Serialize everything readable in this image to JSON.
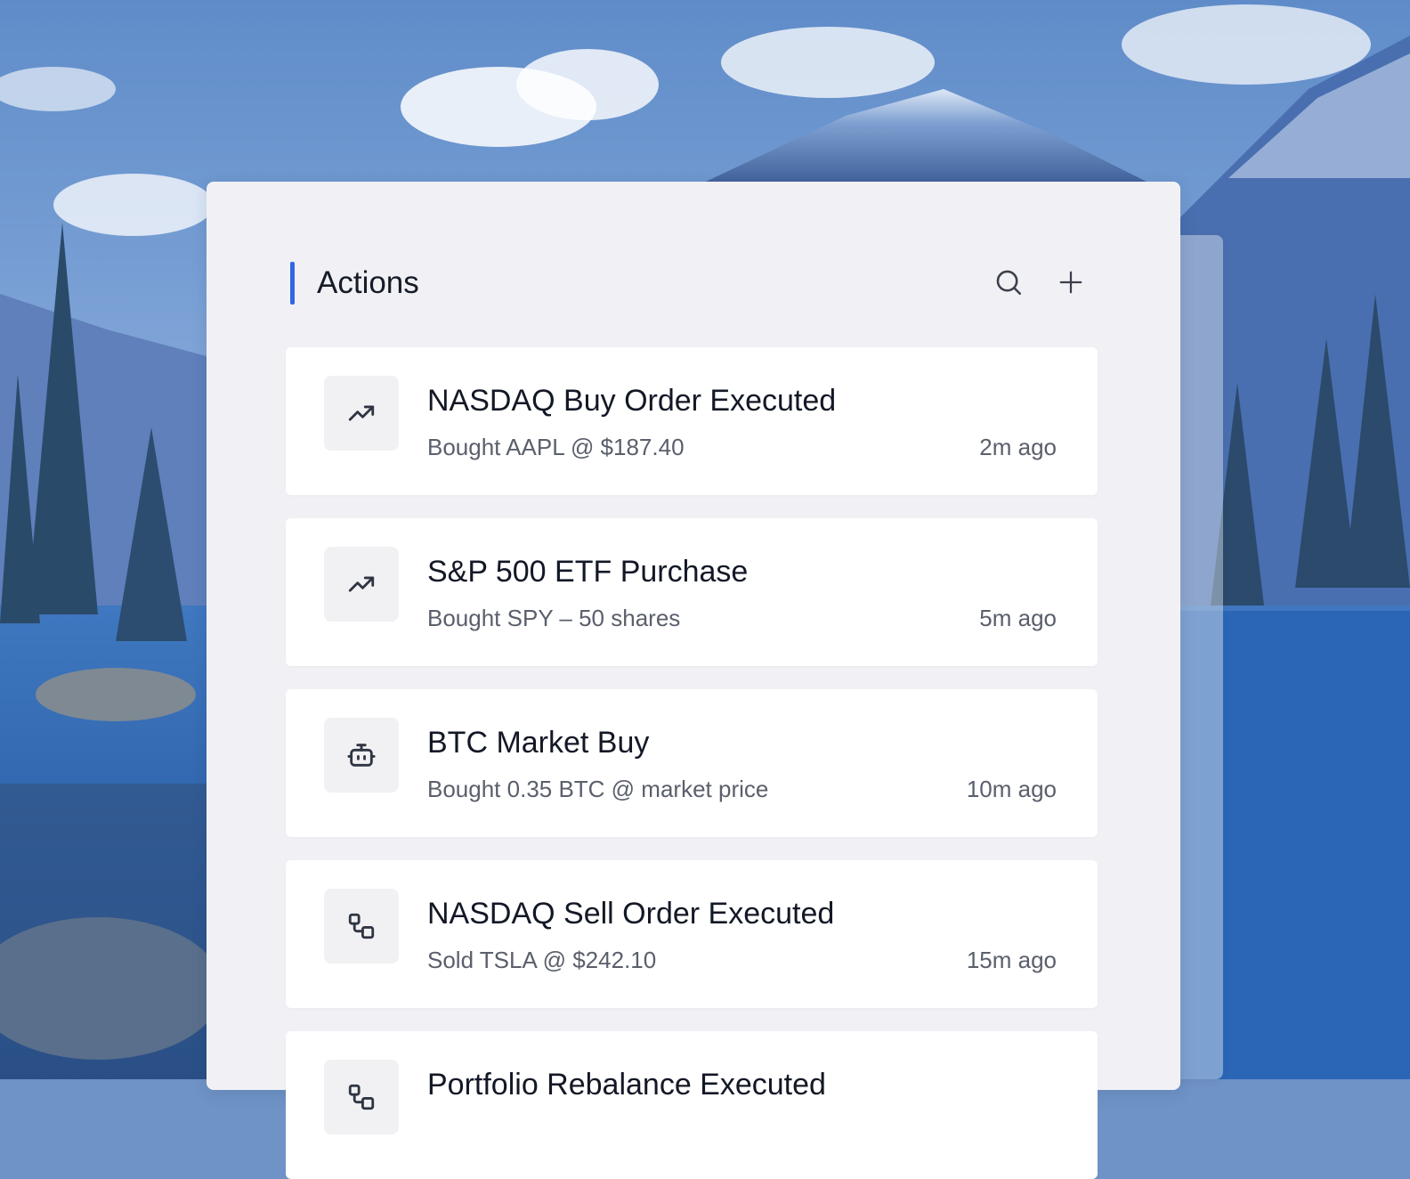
{
  "panel": {
    "title": "Actions",
    "accent_color": "#3366e6",
    "header_icons": [
      "search-icon",
      "plus-icon"
    ]
  },
  "actions": [
    {
      "title": "NASDAQ Buy Order Executed",
      "subtitle": "Bought AAPL @ $187.40",
      "time": "2m ago",
      "icon": "trending-up-icon"
    },
    {
      "title": "S&P 500 ETF Purchase",
      "subtitle": "Bought SPY – 50 shares",
      "time": "5m ago",
      "icon": "trending-up-icon"
    },
    {
      "title": "BTC Market Buy",
      "subtitle": "Bought 0.35 BTC @ market price",
      "time": "10m ago",
      "icon": "bot-icon"
    },
    {
      "title": "NASDAQ Sell Order Executed",
      "subtitle": "Sold TSLA @ $242.10",
      "time": "15m ago",
      "icon": "workflow-icon"
    },
    {
      "title": "Portfolio Rebalance Executed",
      "subtitle": "",
      "time": "",
      "icon": "workflow-icon"
    }
  ]
}
